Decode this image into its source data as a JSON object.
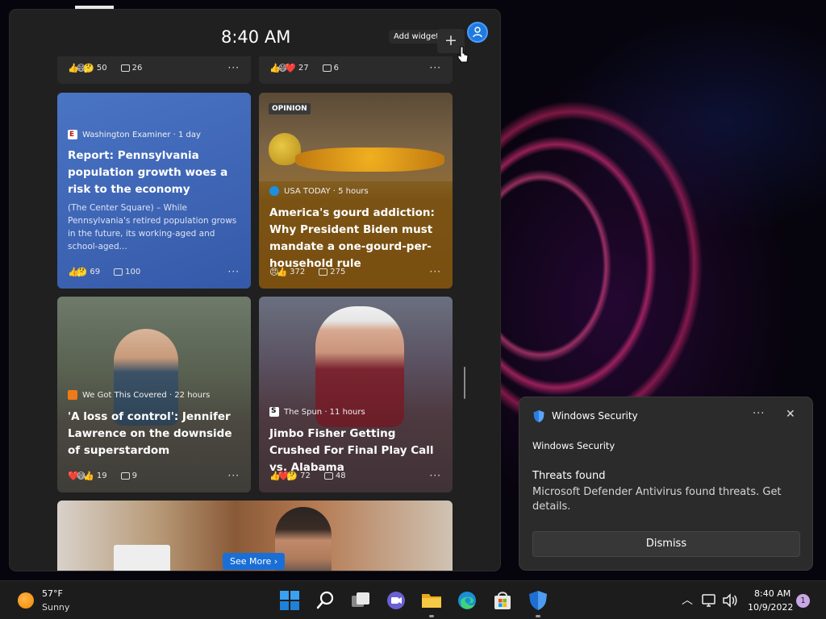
{
  "widgets": {
    "clock": "8:40 AM",
    "add_tooltip": "Add widgets",
    "add_symbol": "+",
    "see_more": "See More ›",
    "more_symbol": "···"
  },
  "stub_cards": [
    {
      "emojis": "👍😅🤔",
      "reactions": "50",
      "comments": "26"
    },
    {
      "emojis": "👍😅❤️",
      "reactions": "27",
      "comments": "6"
    }
  ],
  "cards": [
    {
      "source": "Washington Examiner · 1 day",
      "headline": "Report: Pennsylvania population growth woes a risk to the economy",
      "summary": "(The Center Square) – While Pennsylvania's retired population grows in the future, its working-aged and school-aged...",
      "emojis": "👍🤔",
      "reactions": "69",
      "comments": "100",
      "color": "#3f67b8"
    },
    {
      "badge": "OPINION",
      "source": "USA TODAY · 5 hours",
      "headline": "America's gourd addiction: Why President Biden must mandate a one-gourd-per-household rule",
      "emojis": "😠👍",
      "reactions": "372",
      "comments": "275",
      "color": "#8a5a12"
    },
    {
      "source": "We Got This Covered · 22 hours",
      "headline": "'A loss of control': Jennifer Lawrence on the downside of superstardom",
      "emojis": "❤️😅👍",
      "reactions": "19",
      "comments": "9",
      "color": "#4b4a44"
    },
    {
      "source": "The Spun · 11 hours",
      "headline": "Jimbo Fisher Getting Crushed For Final Play Call vs. Alabama",
      "emojis": "👍❤️🤔",
      "reactions": "72",
      "comments": "48",
      "color": "#4a3a40"
    }
  ],
  "notification": {
    "app": "Windows Security",
    "subtitle": "Windows Security",
    "title": "Threats found",
    "body": "Microsoft Defender Antivirus found threats. Get details.",
    "dismiss": "Dismiss",
    "more": "···",
    "close": "✕"
  },
  "taskbar": {
    "temperature": "57°F",
    "condition": "Sunny",
    "time": "8:40 AM",
    "date": "10/9/2022",
    "notification_count": "1",
    "tray_chevron": "︿"
  }
}
